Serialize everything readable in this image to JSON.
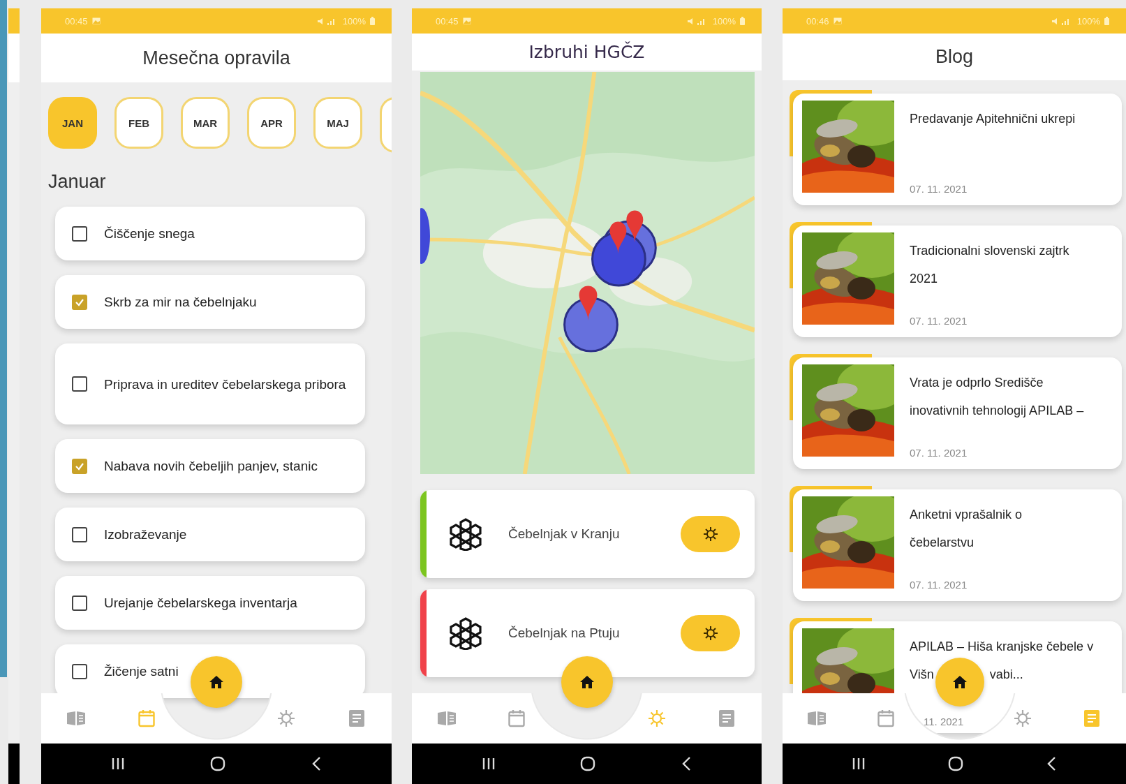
{
  "screens": [
    {
      "kind": "tasks",
      "status_bar": {
        "time": "00:45",
        "battery": "100%"
      },
      "title": "Mesečna opravila",
      "months": [
        {
          "label": "JAN",
          "selected": true
        },
        {
          "label": "FEB",
          "selected": false
        },
        {
          "label": "MAR",
          "selected": false
        },
        {
          "label": "APR",
          "selected": false
        },
        {
          "label": "MAJ",
          "selected": false
        }
      ],
      "month_heading": "Januar",
      "tasks": [
        {
          "label": "Čiščenje snega",
          "checked": false
        },
        {
          "label": "Skrb za mir na čebelnjaku",
          "checked": true
        },
        {
          "label": "Priprava in ureditev čebelarskega pribora",
          "checked": false
        },
        {
          "label": "Nabava novih čebeljih panjev, stanic",
          "checked": true
        },
        {
          "label": "Izobraževanje",
          "checked": false
        },
        {
          "label": "Urejanje čebelarskega inventarja",
          "checked": false
        },
        {
          "label": "Žičenje satni",
          "checked": false
        }
      ],
      "nav": [
        {
          "kind": "guide",
          "selected": false
        },
        {
          "kind": "calendar",
          "selected": true
        },
        {
          "kind": "outbreaks",
          "selected": false
        },
        {
          "kind": "blog",
          "selected": false
        }
      ]
    },
    {
      "kind": "outbreaks",
      "status_bar": {
        "time": "00:45",
        "battery": "100%"
      },
      "title": "Izbruhi HGČZ",
      "apiaries": [
        {
          "name": "Čebelnjak v Kranju",
          "color": "#7cc520"
        },
        {
          "name": "Čebelnjak na Ptuju",
          "color": "#f0424a"
        }
      ],
      "nav": [
        {
          "kind": "guide",
          "selected": false
        },
        {
          "kind": "calendar",
          "selected": false
        },
        {
          "kind": "outbreaks",
          "selected": true
        },
        {
          "kind": "blog",
          "selected": false
        }
      ]
    },
    {
      "kind": "blog",
      "status_bar": {
        "time": "00:46",
        "battery": "100%"
      },
      "title": "Blog",
      "posts": [
        {
          "title_lines": [
            "Predavanje Apitehnični ukrepi"
          ],
          "date": "07. 11. 2021"
        },
        {
          "title_lines": [
            "Tradicionalni slovenski zajtrk",
            "2021"
          ],
          "date": "07. 11. 2021"
        },
        {
          "title_lines": [
            "Vrata je odprlo Središče",
            "inovativnih tehnologij APILAB –"
          ],
          "date": "07. 11. 2021"
        },
        {
          "title_lines": [
            "Anketni vprašalnik o",
            "čebelarstvu"
          ],
          "date": "07. 11. 2021"
        },
        {
          "title_lines": [
            "APILAB – Hiša kranjske čebele v",
            "Višn"
          ],
          "title_after_gap": "vabi...",
          "date": "11. 2021"
        }
      ],
      "nav": [
        {
          "kind": "guide",
          "selected": false
        },
        {
          "kind": "calendar",
          "selected": false
        },
        {
          "kind": "outbreaks",
          "selected": false
        },
        {
          "kind": "blog",
          "selected": true
        }
      ]
    }
  ]
}
